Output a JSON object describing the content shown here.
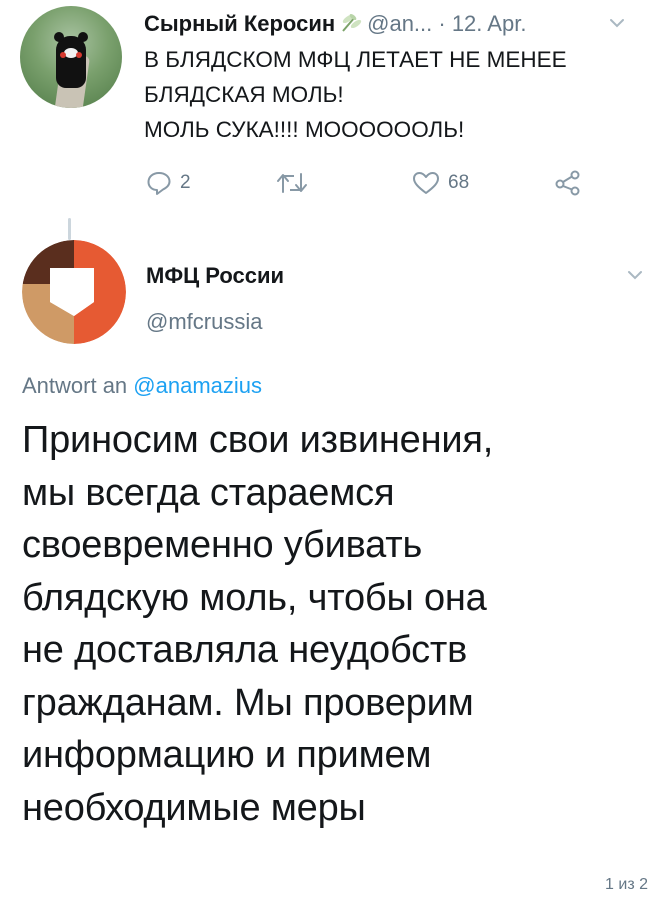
{
  "tweet1": {
    "display_name": "Сырный Керосин",
    "name_icon": "dragonfly-emoji",
    "handle_time": "@an... · 12. Apr.",
    "lines": [
      "В БЛЯДСКОМ МФЦ ЛЕТАЕТ НЕ МЕНЕЕ",
      "БЛЯДСКАЯ МОЛЬ!",
      "МОЛЬ СУКА!!!! МООООООЛЬ!"
    ],
    "reply_count": "2",
    "retweet_count": "",
    "like_count": "68",
    "icons": [
      "reply-icon",
      "retweet-icon",
      "like-icon",
      "share-icon",
      "chevron-down-icon"
    ]
  },
  "tweet2": {
    "display_name": "МФЦ России",
    "handle": "@mfcrussia",
    "reply_prefix": "Antwort an ",
    "reply_mention": "@anamazius",
    "lines": [
      "Приносим свои извинения,",
      "мы всегда стараемся",
      "своевременно убивать",
      "блядскую моль, чтобы она",
      "не доставляла неудобств",
      "гражданам. Мы проверим",
      "информацию и примем",
      "необходимые меры"
    ],
    "brand_colors": {
      "brown": "#5a2e1e",
      "orange": "#e65a33",
      "tan": "#cf9a66"
    }
  },
  "page_counter": "1 из 2",
  "colors": {
    "text": "#14171a",
    "muted": "#657786",
    "link": "#1da1f2",
    "divider": "#ccd6dd"
  }
}
